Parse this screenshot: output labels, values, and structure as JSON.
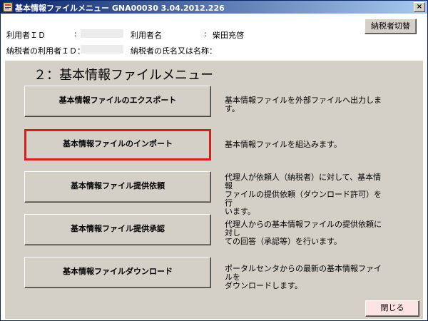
{
  "window": {
    "title": "基本情報ファイルメニュー GNA00030  3.04.2012.226"
  },
  "header": {
    "user_id_label": "利用者ＩＤ",
    "user_id_sep": ":",
    "user_name_label": "利用者名",
    "user_name_sep": ":",
    "user_name_value": "柴田充啓",
    "taxpayer_user_id_label": "納税者の利用者ＩＤ：",
    "taxpayer_name_label": "納税者の氏名又は名称：",
    "switch_taxpayer_label": "納税者切替"
  },
  "menu": {
    "heading": "２：基本情報ファイルメニュー",
    "items": [
      {
        "label": "基本情報ファイルのエクスポート",
        "description": "基本情報ファイルを外部ファイルへ出力します。",
        "selected": false
      },
      {
        "label": "基本情報ファイルのインポート",
        "description": "基本情報ファイルを組込みます。",
        "selected": true
      },
      {
        "label": "基本情報ファイル提供依頼",
        "description": "代理人が依頼人（納税者）に対して、基本情報\nファイルの提供依頼（ダウンロード許可）を行\nいます。",
        "selected": false
      },
      {
        "label": "基本情報ファイル提供承認",
        "description": "代理人からの基本情報ファイルの提供依頼に対し\nての回答（承認等）を行います。",
        "selected": false
      },
      {
        "label": "基本情報ファイルダウンロード",
        "description": "ポータルセンタからの最新の基本情報ファイルを\nダウンロードします。",
        "selected": false
      }
    ]
  },
  "footer": {
    "close_label": "閉じる"
  },
  "colors": {
    "title_bar": "#0a246a",
    "panel": "#d4d0c8",
    "selected_border": "#d02020",
    "close_button": "#fde3e3"
  }
}
